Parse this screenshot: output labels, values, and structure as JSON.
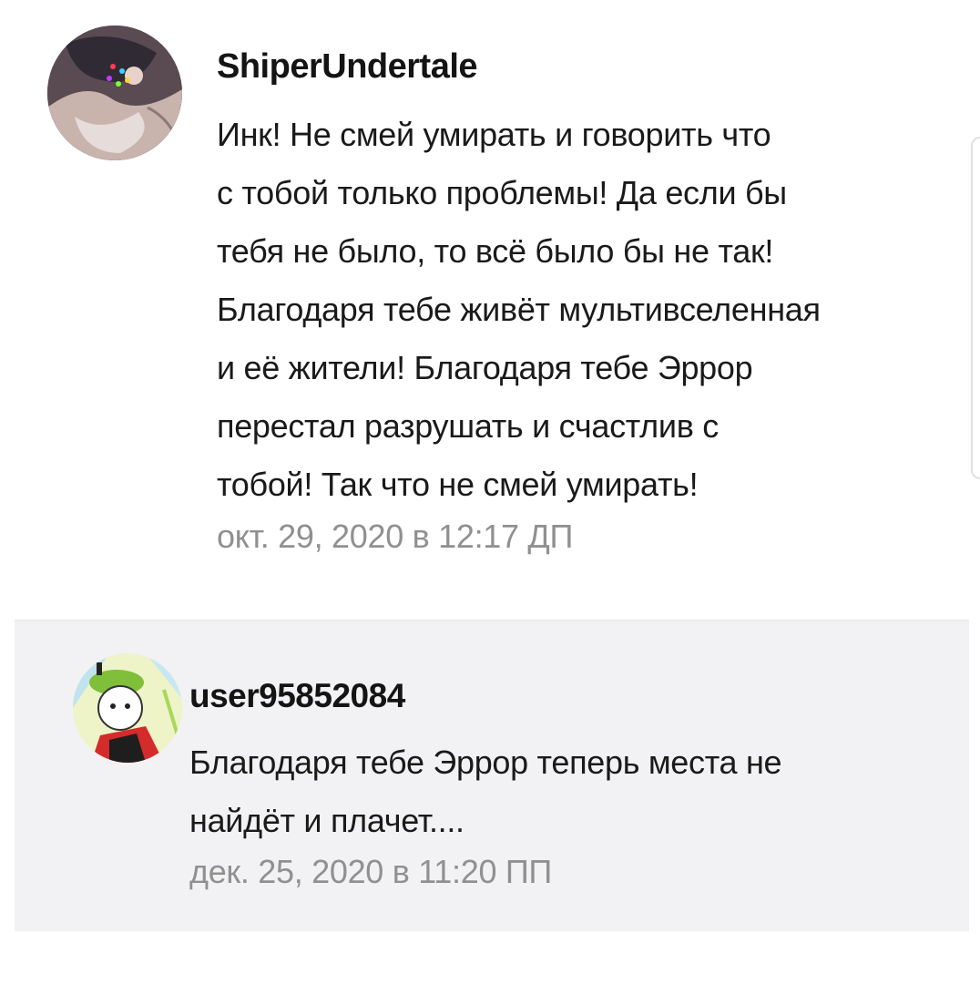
{
  "comments": [
    {
      "username": "ShiperUndertale",
      "lines": [
        "Инк! Не смей умирать и говорить что",
        "с тобой только проблемы! Да если бы",
        "тебя не было, то всё было бы не так!",
        "Благодаря тебе живёт мультивселенная",
        "и её жители! Благодаря тебе Эррор",
        "перестал разрушать и счастлив с",
        "тобой! Так что не смей умирать!"
      ],
      "timestamp": "окт. 29, 2020 в 12:17 ДП",
      "avatar_icon": "user-avatar"
    },
    {
      "username": "user95852084",
      "lines": [
        "Благодаря тебе Эррор теперь места не",
        "найдёт и плачет...."
      ],
      "timestamp": "дек. 25, 2020 в 11:20 ПП",
      "avatar_icon": "user-avatar"
    }
  ],
  "colors": {
    "background": "#ffffff",
    "reply_background": "#f2f2f4",
    "username": "#141414",
    "body": "#1a1a1a",
    "timestamp": "#909090"
  }
}
